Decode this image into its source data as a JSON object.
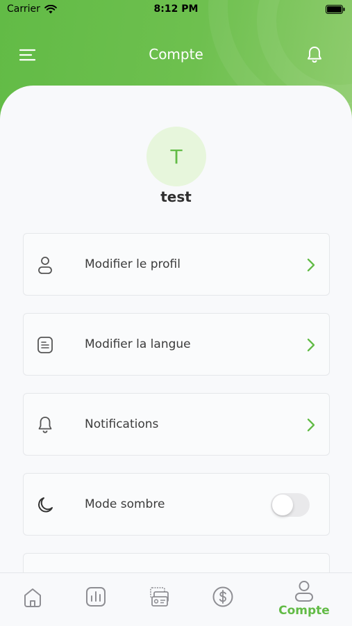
{
  "status_bar": {
    "carrier": "Carrier",
    "time": "8:12 PM"
  },
  "header": {
    "title": "Compte",
    "icons": [
      "menu-icon",
      "bell-icon"
    ]
  },
  "profile": {
    "initial": "T",
    "username": "test"
  },
  "settings": {
    "items": [
      {
        "label": "Modifier le profil",
        "icon": "user-icon",
        "control": "chevron"
      },
      {
        "label": "Modifier la langue",
        "icon": "document-icon",
        "control": "chevron"
      },
      {
        "label": "Notifications",
        "icon": "bell-icon",
        "control": "chevron"
      },
      {
        "label": "Mode sombre",
        "icon": "moon-icon",
        "control": "toggle",
        "toggle_on": false
      }
    ]
  },
  "tab_bar": {
    "tabs": [
      {
        "icon": "home-icon"
      },
      {
        "icon": "chart-icon"
      },
      {
        "icon": "cards-icon"
      },
      {
        "icon": "dollar-icon"
      },
      {
        "icon": "account-icon",
        "label": "Compte",
        "active": true
      }
    ]
  },
  "colors": {
    "brand_green": "#62bb46",
    "header_gradient_end": "#8fcc6e",
    "background": "#f8f9fb",
    "text_dark": "#3b3b3b",
    "icon_gray": "#8e8e93",
    "avatar_bg": "#e7f6dc"
  }
}
